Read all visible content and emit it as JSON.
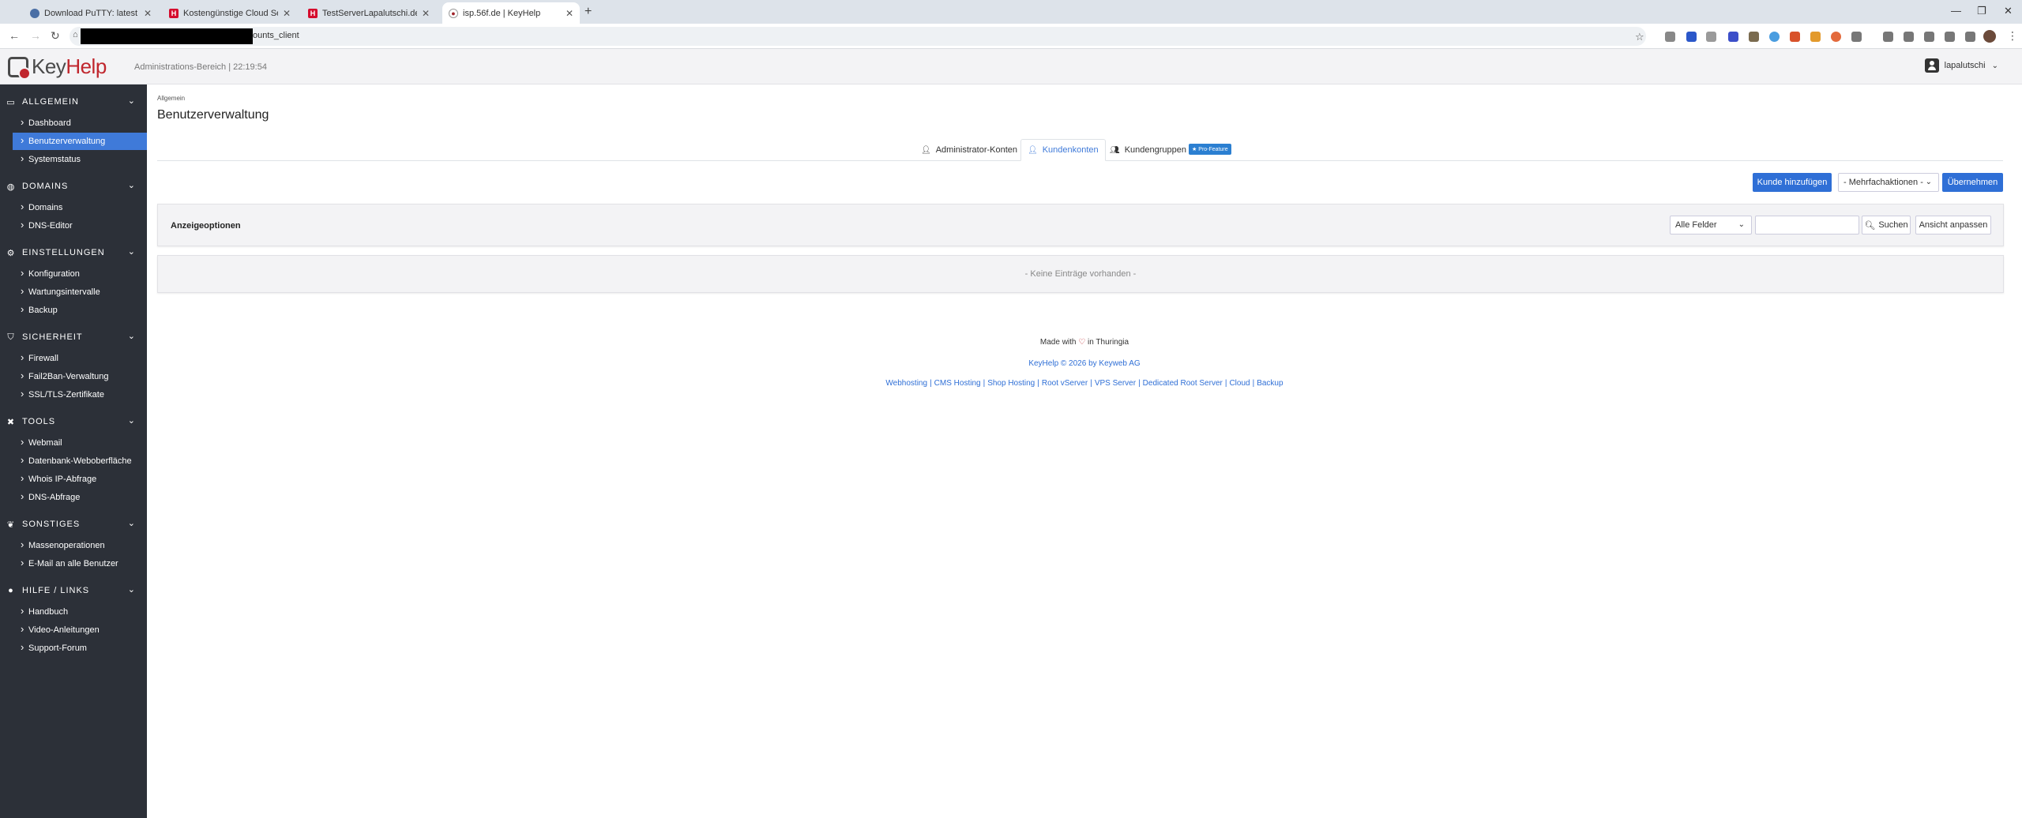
{
  "browser": {
    "tabs": [
      {
        "title": "Download PuTTY: latest release",
        "active": false
      },
      {
        "title": "Kostengünstige Cloud Server für",
        "active": false
      },
      {
        "title": "TestServerLapalutschi.de - Hetzn",
        "active": false
      },
      {
        "title": "isp.56f.de | KeyHelp",
        "active": true
      }
    ],
    "address": "ounts_client"
  },
  "header": {
    "logo_key": "Key",
    "logo_help": "Help",
    "admin_area": "Administrations-Bereich | 22:19:54",
    "username": "lapalutschi"
  },
  "sidebar": {
    "sections": [
      {
        "title": "ALLGEMEIN",
        "icon": "monitor-icon",
        "items": [
          "Dashboard",
          "Benutzerverwaltung",
          "Systemstatus"
        ]
      },
      {
        "title": "DOMAINS",
        "icon": "globe-icon",
        "items": [
          "Domains",
          "DNS-Editor"
        ]
      },
      {
        "title": "EINSTELLUNGEN",
        "icon": "cogs-icon",
        "items": [
          "Konfiguration",
          "Wartungsintervalle",
          "Backup"
        ]
      },
      {
        "title": "SICHERHEIT",
        "icon": "shield-icon",
        "items": [
          "Firewall",
          "Fail2Ban-Verwaltung",
          "SSL/TLS-Zertifikate"
        ]
      },
      {
        "title": "TOOLS",
        "icon": "tools-icon",
        "items": [
          "Webmail",
          "Datenbank-Weboberfläche",
          "Whois IP-Abfrage",
          "DNS-Abfrage"
        ]
      },
      {
        "title": "SONSTIGES",
        "icon": "leaf-icon",
        "items": [
          "Massenoperationen",
          "E-Mail an alle Benutzer"
        ]
      },
      {
        "title": "HILFE / LINKS",
        "icon": "info-icon",
        "items": [
          "Handbuch",
          "Video-Anleitungen",
          "Support-Forum"
        ]
      }
    ],
    "active_item": "Benutzerverwaltung"
  },
  "main": {
    "breadcrumb": "Allgemein",
    "title": "Benutzerverwaltung",
    "tabs": [
      {
        "label": "Administrator-Konten",
        "active": false
      },
      {
        "label": "Kundenkonten",
        "active": true
      },
      {
        "label": "Kundengruppen",
        "active": false
      }
    ],
    "pro_badge": "Pro-Feature",
    "add_customer": "Kunde hinzufügen",
    "bulk_actions": "- Mehrfachaktionen -",
    "apply": "Übernehmen",
    "display_options": "Anzeigeoptionen",
    "field_select": "Alle Felder",
    "search_button": "Suchen",
    "customize_view": "Ansicht anpassen",
    "empty": "- Keine Einträge vorhanden -"
  },
  "footer": {
    "made_with": "Made with",
    "in_place": "in Thuringia",
    "copyright": "KeyHelp © 2026 by Keyweb AG",
    "links": [
      "Webhosting",
      "CMS Hosting",
      "Shop Hosting",
      "Root vServer",
      "VPS Server",
      "Dedicated Root Server",
      "Cloud",
      "Backup"
    ]
  }
}
